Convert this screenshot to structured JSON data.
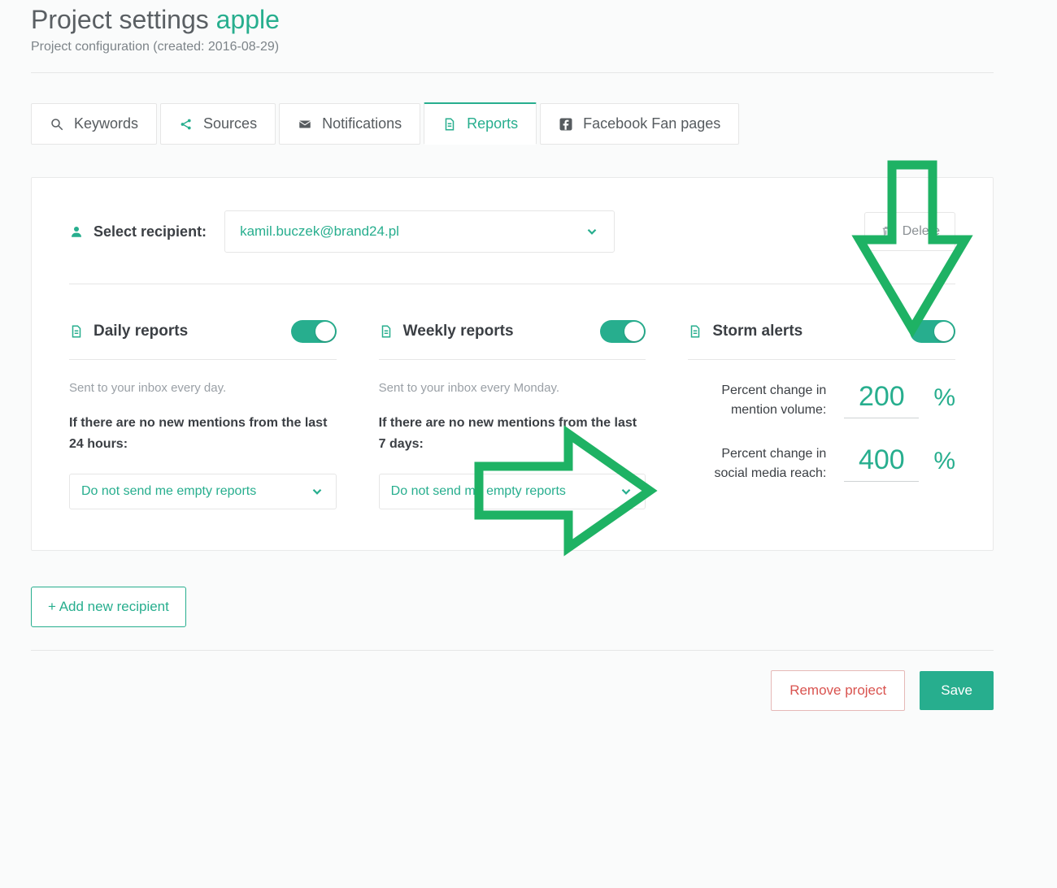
{
  "header": {
    "title_prefix": "Project settings ",
    "project_name": "apple",
    "subtitle": "Project configuration (created: 2016-08-29)"
  },
  "tabs": {
    "keywords": "Keywords",
    "sources": "Sources",
    "notifications": "Notifications",
    "reports": "Reports",
    "facebook": "Facebook Fan pages"
  },
  "recipient": {
    "label": "Select recipient:",
    "selected": "kamil.buczek@brand24.pl",
    "delete_label": "Delete"
  },
  "daily": {
    "title": "Daily reports",
    "enabled": true,
    "desc": "Sent to your inbox every day.",
    "subhead": "If there are no new mentions from the last 24 hours:",
    "empty_option": "Do not send me empty reports"
  },
  "weekly": {
    "title": "Weekly reports",
    "enabled": true,
    "desc": "Sent to your inbox every Monday.",
    "subhead": "If there are no new mentions from the last 7 days:",
    "empty_option": "Do not send me empty reports"
  },
  "storm": {
    "title": "Storm alerts",
    "enabled": true,
    "mention_label": "Percent change in mention volume:",
    "mention_value": "200",
    "reach_label": "Percent change in social media reach:",
    "reach_value": "400",
    "percent_sign": "%"
  },
  "actions": {
    "add_recipient": "+ Add new recipient",
    "remove_project": "Remove project",
    "save": "Save"
  }
}
